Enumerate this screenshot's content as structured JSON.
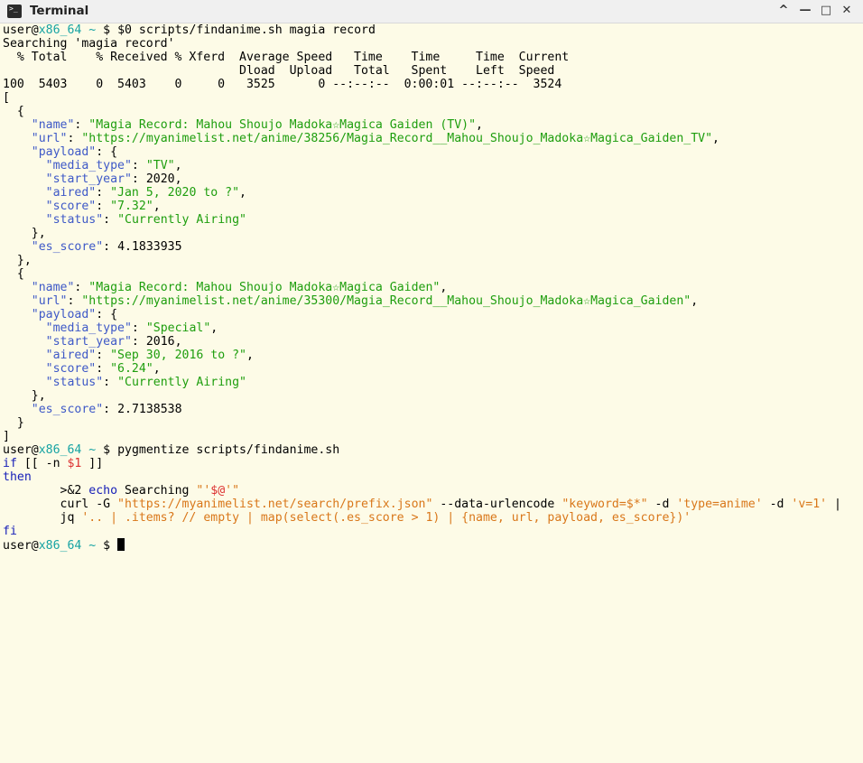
{
  "window": {
    "title": "Terminal",
    "controls": {
      "minimize": "^",
      "shrink": "—",
      "maximize": "□",
      "close": "✕"
    }
  },
  "prompt": {
    "user": "user@",
    "host": "x86_64",
    "path": " ~ ",
    "symbol": "$ "
  },
  "cmd1": "$0 scripts/findanime.sh magia record",
  "searching": "Searching 'magia record'",
  "curl_header1": "  % Total    % Received % Xferd  Average Speed   Time    Time     Time  Current",
  "curl_header2": "                                 Dload  Upload   Total   Spent    Left  Speed",
  "curl_progress": "100  5403    0  5403    0     0   3525      0 --:--:--  0:00:01 --:--:--  3524",
  "json": {
    "open": "[",
    "close": "]",
    "items": [
      {
        "name_key": "\"name\"",
        "name_val": "\"Magia Record: Mahou Shoujo Madoka☆Magica Gaiden (TV)\"",
        "url_key": "\"url\"",
        "url_val": "\"https://myanimelist.net/anime/38256/Magia_Record__Mahou_Shoujo_Madoka☆Magica_Gaiden_TV\"",
        "payload_key": "\"payload\"",
        "media_type_key": "\"media_type\"",
        "media_type_val": "\"TV\"",
        "start_year_key": "\"start_year\"",
        "start_year_val": "2020",
        "aired_key": "\"aired\"",
        "aired_val": "\"Jan 5, 2020 to ?\"",
        "score_key": "\"score\"",
        "score_val": "\"7.32\"",
        "status_key": "\"status\"",
        "status_val": "\"Currently Airing\"",
        "es_score_key": "\"es_score\"",
        "es_score_val": "4.1833935"
      },
      {
        "name_key": "\"name\"",
        "name_val": "\"Magia Record: Mahou Shoujo Madoka☆Magica Gaiden\"",
        "url_key": "\"url\"",
        "url_val": "\"https://myanimelist.net/anime/35300/Magia_Record__Mahou_Shoujo_Madoka☆Magica_Gaiden\"",
        "payload_key": "\"payload\"",
        "media_type_key": "\"media_type\"",
        "media_type_val": "\"Special\"",
        "start_year_key": "\"start_year\"",
        "start_year_val": "2016",
        "aired_key": "\"aired\"",
        "aired_val": "\"Sep 30, 2016 to ?\"",
        "score_key": "\"score\"",
        "score_val": "\"6.24\"",
        "status_key": "\"status\"",
        "status_val": "\"Currently Airing\"",
        "es_score_key": "\"es_score\"",
        "es_score_val": "2.7138538"
      }
    ]
  },
  "cmd2": "pygmentize scripts/findanime.sh",
  "script": {
    "if_kw": "if",
    "if_open": " [[ -n ",
    "if_var": "$1",
    "if_close": " ]]",
    "then_kw": "then",
    "echo_redir": "        >&2 ",
    "echo_kw": "echo",
    "echo_word": " Searching ",
    "echo_q1": "\"'",
    "echo_var": "$@",
    "echo_q2": "'\"",
    "curl_cmd": "        curl -G ",
    "curl_url": "\"https://myanimelist.net/search/prefix.json\"",
    "curl_opt": " --data-urlencode ",
    "curl_kw": "\"keyword=$*\"",
    "curl_d1": " -d ",
    "curl_type": "'type=anime'",
    "curl_d2": " -d ",
    "curl_v": "'v=1'",
    "curl_pipe": " |",
    "jq_cmd": "        jq ",
    "jq_filter": "'.. | .items? // empty | map(select(.es_score > 1) | {name, url, payload, es_score})'",
    "fi_kw": "fi"
  }
}
